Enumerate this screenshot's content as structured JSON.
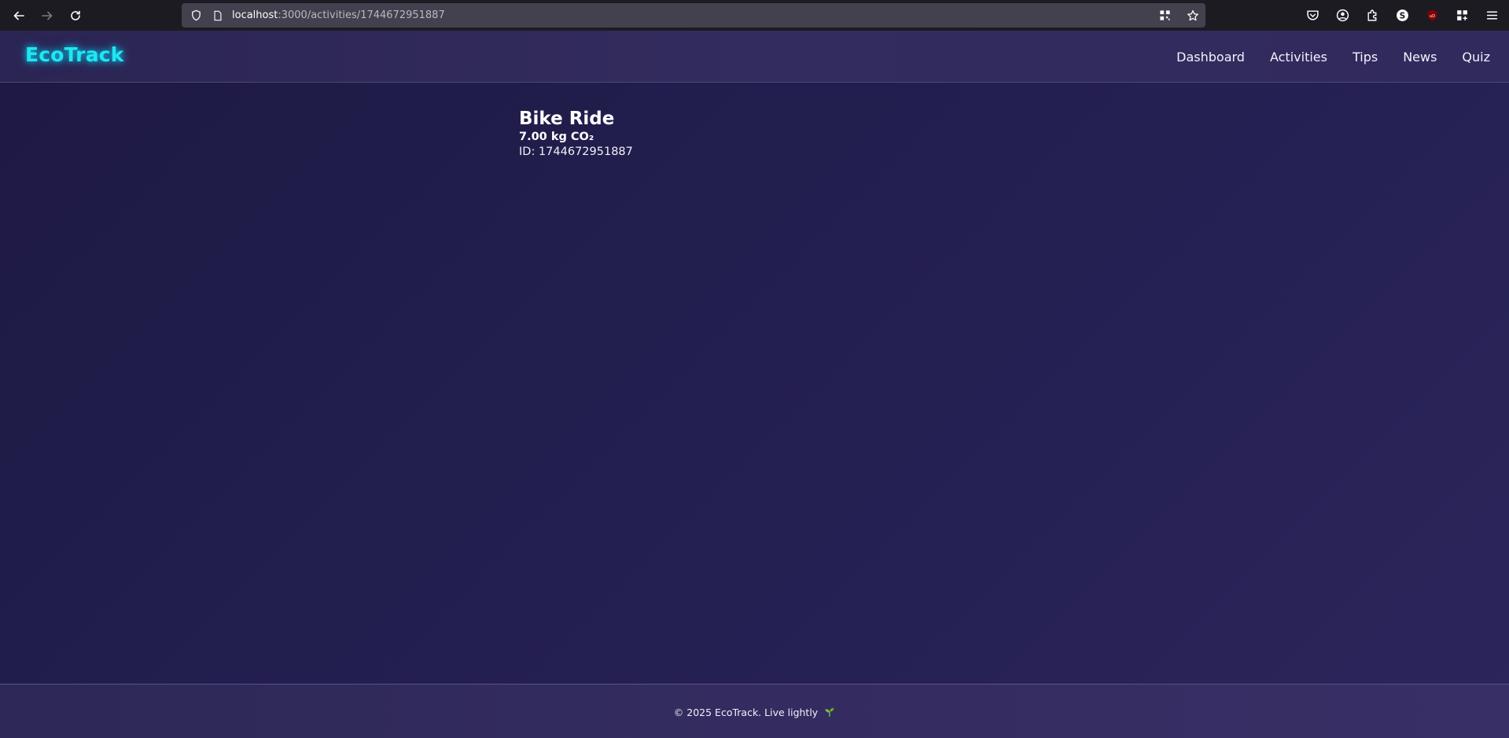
{
  "browser": {
    "url_host": "localhost",
    "url_path": ":3000/activities/1744672951887",
    "icons": {
      "back": "back-arrow-icon",
      "forward": "forward-arrow-icon",
      "reload": "reload-icon",
      "shield": "shield-icon",
      "page": "page-icon",
      "qr": "qr-code-icon",
      "bookmark": "star-icon",
      "pocket": "pocket-icon",
      "account": "account-icon",
      "extensions": "puzzle-icon",
      "s_ext": "s-extension-icon",
      "ublock": "ublock-icon",
      "apps": "apps-icon",
      "menu": "hamburger-menu-icon"
    }
  },
  "header": {
    "logo": "EcoTrack",
    "nav": [
      {
        "label": "Dashboard"
      },
      {
        "label": "Activities"
      },
      {
        "label": "Tips"
      },
      {
        "label": "News"
      },
      {
        "label": "Quiz"
      }
    ]
  },
  "activity": {
    "title": "Bike Ride",
    "co2": "7.00 kg CO₂",
    "id_text": "ID: 1744672951887"
  },
  "footer": {
    "text": "© 2025 EcoTrack. Live lightly",
    "icon": "sprout-icon"
  },
  "colors": {
    "logo": "#22e6f0",
    "page_bg": "#231f50",
    "header_bg": "#2f2859"
  }
}
